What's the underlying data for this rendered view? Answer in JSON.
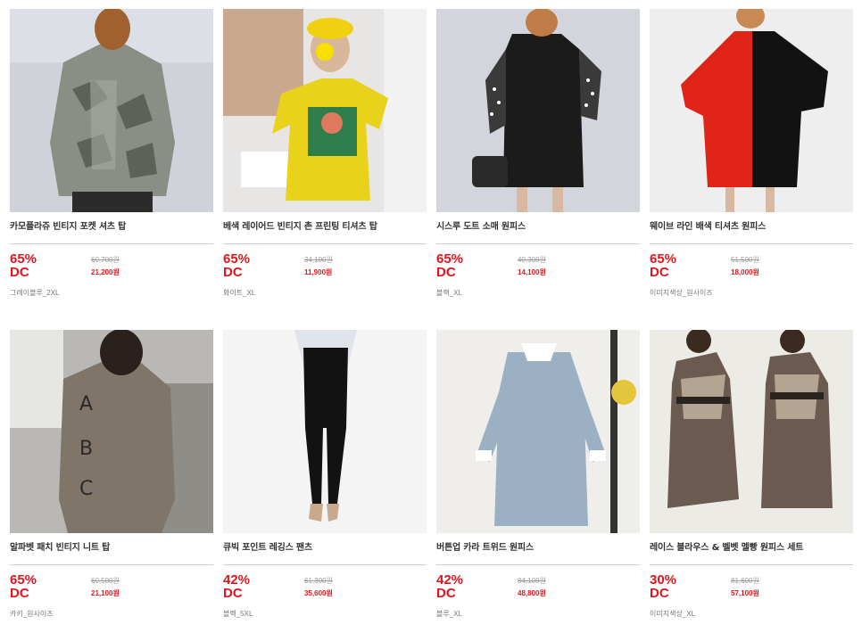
{
  "products": [
    {
      "name": "카모플라쥬 빈티지 포켓 셔츠 탑",
      "discount_pct": "65%",
      "discount_label": "DC",
      "original_price": "60,700원",
      "sale_price": "21,200원",
      "option": "그레이블루_2XL",
      "image": "camo-shirt-photo"
    },
    {
      "name": "베색 레이어드 빈티지 촌 프린팅 티셔츠 탑",
      "discount_pct": "65%",
      "discount_label": "DC",
      "original_price": "34,100원",
      "sale_price": "11,900원",
      "option": "화이트_XL",
      "image": "yellow-tshirt-photo"
    },
    {
      "name": "시스루 도트 소매 원피스",
      "discount_pct": "65%",
      "discount_label": "DC",
      "original_price": "40,300원",
      "sale_price": "14,100원",
      "option": "블랙_XL",
      "image": "black-dot-dress-photo"
    },
    {
      "name": "웨이브 라인 배색 티셔츠 원피스",
      "discount_pct": "65%",
      "discount_label": "DC",
      "original_price": "51,500원",
      "sale_price": "18,000원",
      "option": "이미지색상_원사이즈",
      "image": "red-black-dress-photo"
    },
    {
      "name": "알파벳 패치 빈티지 니트 탑",
      "discount_pct": "65%",
      "discount_label": "DC",
      "original_price": "60,500원",
      "sale_price": "21,100원",
      "option": "카키_원사이즈",
      "image": "abc-knit-photo"
    },
    {
      "name": "큐빅 포인트 레깅스 팬츠",
      "discount_pct": "42%",
      "discount_label": "DC",
      "original_price": "61,300원",
      "sale_price": "35,600원",
      "option": "블랙_5XL",
      "image": "black-leggings-photo"
    },
    {
      "name": "버튼업 카라 트위드 원피스",
      "discount_pct": "42%",
      "discount_label": "DC",
      "original_price": "84,100원",
      "sale_price": "48,800원",
      "option": "블루_XL",
      "image": "blue-tweed-dress-photo"
    },
    {
      "name": "레이스 블라우스 & 벨벳 멜빵 원피스 세트",
      "discount_pct": "30%",
      "discount_label": "DC",
      "original_price": "81,600원",
      "sale_price": "57,100원",
      "option": "이미지색상_XL",
      "image": "velvet-dress-set-photo"
    }
  ],
  "colors": {
    "discount": "#e3141d",
    "divider": "#cfcfcf",
    "name": "#333333",
    "muted": "#9a9a9a"
  }
}
